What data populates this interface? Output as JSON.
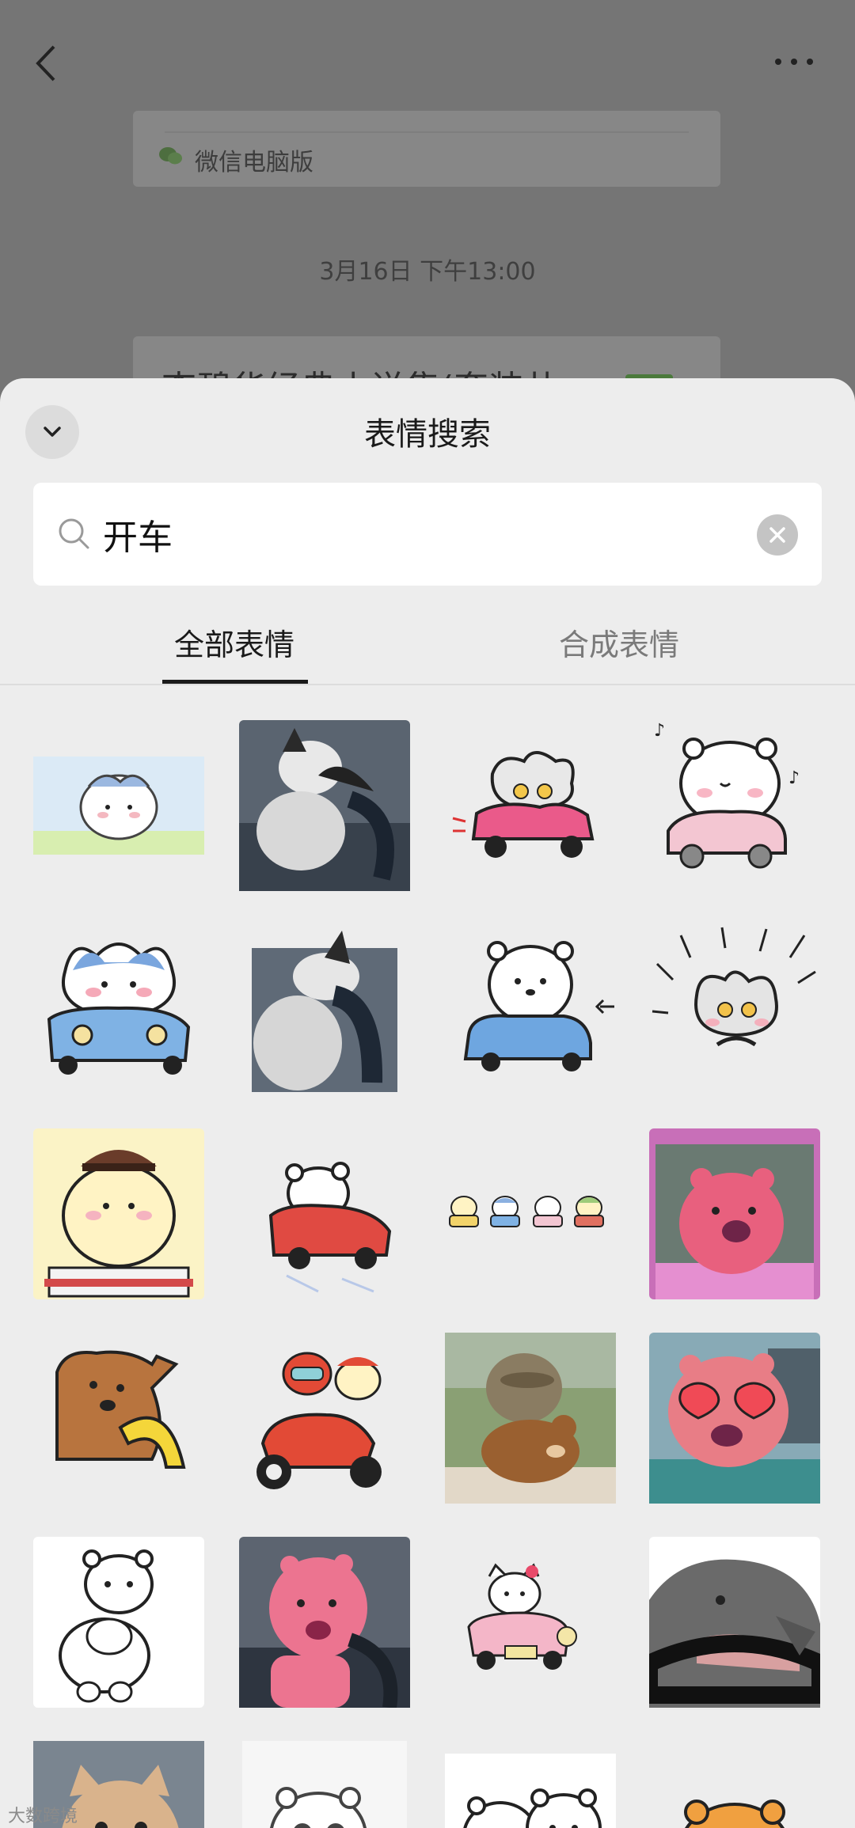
{
  "chat": {
    "pc_source_label": "微信电脑版",
    "timestamp": "3月16日 下午13:00",
    "card_title": "李碧华经典小说集(套装共"
  },
  "sheet": {
    "title": "表情搜索",
    "search": {
      "value": "开车",
      "placeholder": ""
    },
    "tabs": [
      {
        "label": "全部表情",
        "active": true
      },
      {
        "label": "合成表情",
        "active": false
      }
    ]
  },
  "stickers": [
    {
      "desc": "blue-white-cat-driving"
    },
    {
      "desc": "cat-driving-photo"
    },
    {
      "desc": "gray-character-pink-car"
    },
    {
      "desc": "white-bear-pink-car"
    },
    {
      "desc": "blue-cat-blue-car"
    },
    {
      "desc": "cat-driving-photo-2"
    },
    {
      "desc": "bear-blue-car"
    },
    {
      "desc": "gray-character-excited"
    },
    {
      "desc": "yellow-dog-conductor"
    },
    {
      "desc": "bear-red-car"
    },
    {
      "desc": "four-characters-cars"
    },
    {
      "desc": "pink-beaver-car-3d"
    },
    {
      "desc": "brown-dog-steering"
    },
    {
      "desc": "characters-red-scooter"
    },
    {
      "desc": "seal-plush-photo"
    },
    {
      "desc": "pink-beaver-heart-glasses"
    },
    {
      "desc": "bear-seal-riding"
    },
    {
      "desc": "pink-beaver-driving-3d"
    },
    {
      "desc": "hello-kitty-pink-car"
    },
    {
      "desc": "animal-steering-wheel"
    },
    {
      "desc": "cat-photo-partial"
    },
    {
      "desc": "bear-sketch-partial"
    },
    {
      "desc": "two-bears-partial"
    },
    {
      "desc": "orange-bear-partial"
    }
  ],
  "watermark": "大数跨境",
  "colors": {
    "sheet_bg": "#ededed",
    "overlay": "#757575",
    "tab_active": "#1a1a1a",
    "tab_inactive": "#7a7a7a"
  }
}
